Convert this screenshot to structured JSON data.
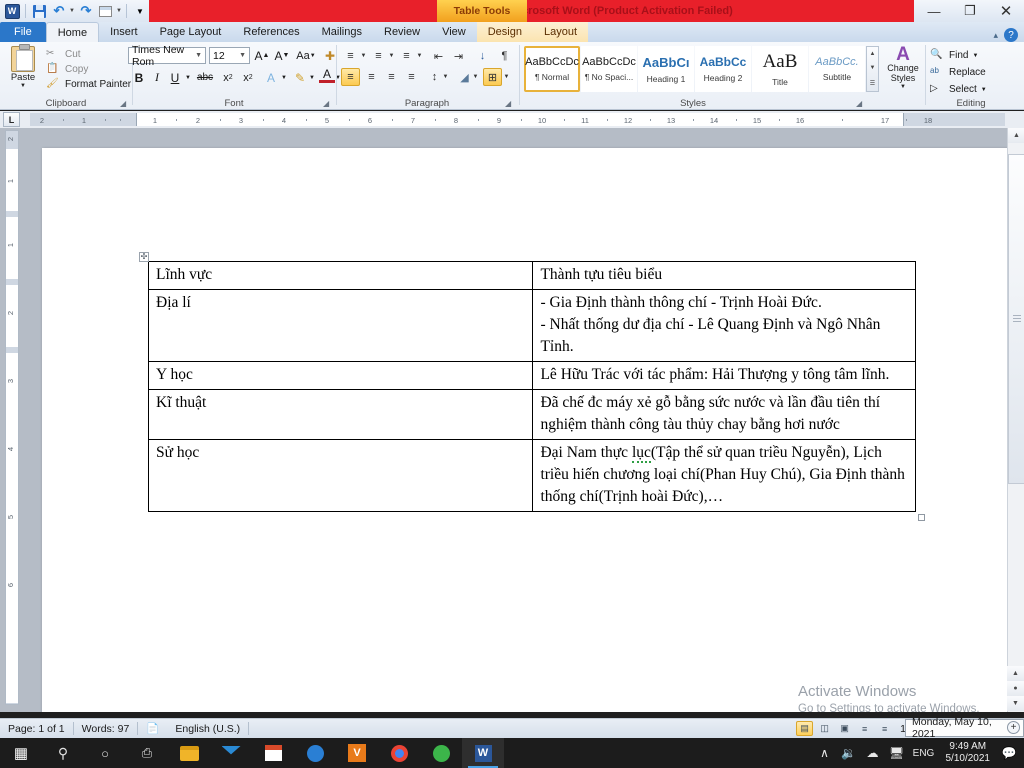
{
  "titlebar": {
    "app_icon": "word-logo-icon",
    "document_title": "Document1  -  Microsoft Word (Product Activation Failed)",
    "contextual_tab_group": "Table Tools",
    "quick_access": [
      {
        "name": "save-icon",
        "label": "Save"
      },
      {
        "name": "undo-icon",
        "label": "Undo"
      },
      {
        "name": "redo-icon",
        "label": "Redo"
      },
      {
        "name": "table-quick-icon",
        "label": "Table"
      },
      {
        "name": "customize-qat-icon",
        "label": "Customize Quick Access Toolbar"
      }
    ],
    "window_controls": [
      {
        "name": "minimize-button",
        "glyph": "—"
      },
      {
        "name": "restore-button",
        "glyph": "❐"
      },
      {
        "name": "close-button",
        "glyph": "✕"
      }
    ],
    "ribbon_collapse": "▴",
    "help": "?"
  },
  "tabs": [
    {
      "label": "File",
      "kind": "file"
    },
    {
      "label": "Home",
      "kind": "active"
    },
    {
      "label": "Insert",
      "kind": "normal"
    },
    {
      "label": "Page Layout",
      "kind": "normal"
    },
    {
      "label": "References",
      "kind": "normal"
    },
    {
      "label": "Mailings",
      "kind": "normal"
    },
    {
      "label": "Review",
      "kind": "normal"
    },
    {
      "label": "View",
      "kind": "normal"
    },
    {
      "label": "Design",
      "kind": "ctx"
    },
    {
      "label": "Layout",
      "kind": "ctx"
    }
  ],
  "ribbon": {
    "groups": [
      {
        "name": "clipboard",
        "label": "Clipboard"
      },
      {
        "name": "font",
        "label": "Font"
      },
      {
        "name": "paragraph",
        "label": "Paragraph"
      },
      {
        "name": "styles",
        "label": "Styles"
      },
      {
        "name": "editing",
        "label": "Editing"
      }
    ],
    "clipboard": {
      "paste_label": "Paste",
      "commands": [
        {
          "label": "Cut",
          "icon": "scissors-icon",
          "enabled": false
        },
        {
          "label": "Copy",
          "icon": "copy-icon",
          "enabled": false
        },
        {
          "label": "Format Painter",
          "icon": "format-painter-icon",
          "enabled": true
        }
      ]
    },
    "font": {
      "font_name": "Times New Rom",
      "font_size": "12",
      "buttons": [
        {
          "name": "grow-font-button",
          "glyph": "A˄"
        },
        {
          "name": "shrink-font-button",
          "glyph": "A˅"
        },
        {
          "name": "change-case-button",
          "glyph": "Aa"
        },
        {
          "name": "clear-formatting-button",
          "glyph": "✐"
        },
        {
          "name": "bold-button",
          "glyph": "B"
        },
        {
          "name": "italic-button",
          "glyph": "I"
        },
        {
          "name": "underline-button",
          "glyph": "U"
        },
        {
          "name": "strikethrough-button",
          "glyph": "abc"
        },
        {
          "name": "subscript-button",
          "glyph": "x₂"
        },
        {
          "name": "superscript-button",
          "glyph": "x²"
        },
        {
          "name": "text-effects-button",
          "glyph": "A"
        },
        {
          "name": "highlight-color-button",
          "glyph": "✐"
        },
        {
          "name": "font-color-button",
          "glyph": "A"
        }
      ]
    },
    "paragraph": {
      "buttons": [
        {
          "name": "bullets-button",
          "glyph": "≣"
        },
        {
          "name": "numbering-button",
          "glyph": "≣"
        },
        {
          "name": "multilevel-list-button",
          "glyph": "≣"
        },
        {
          "name": "decrease-indent-button",
          "glyph": "⇤"
        },
        {
          "name": "increase-indent-button",
          "glyph": "⇥"
        },
        {
          "name": "sort-button",
          "glyph": "↓"
        },
        {
          "name": "show-formatting-marks-button",
          "glyph": "¶"
        },
        {
          "name": "align-left-button",
          "glyph": "≡",
          "selected": true
        },
        {
          "name": "align-center-button",
          "glyph": "≡"
        },
        {
          "name": "align-right-button",
          "glyph": "≡"
        },
        {
          "name": "justify-button",
          "glyph": "≡"
        },
        {
          "name": "line-spacing-button",
          "glyph": "↕"
        },
        {
          "name": "shading-button",
          "glyph": "◢"
        },
        {
          "name": "borders-button",
          "glyph": "⊞"
        }
      ]
    },
    "styles": {
      "items": [
        {
          "preview": "AaBbCcDc",
          "name": "¶ Normal",
          "selected": true
        },
        {
          "preview": "AaBbCcDc",
          "name": "¶ No Spaci...",
          "selected": false
        },
        {
          "preview": "AaBbCı",
          "name": "Heading 1",
          "selected": false
        },
        {
          "preview": "AaBbCc",
          "name": "Heading 2",
          "selected": false
        },
        {
          "preview": "AaB",
          "name": "Title",
          "selected": false
        },
        {
          "preview": "AaBbCc.",
          "name": "Subtitle",
          "selected": false
        }
      ],
      "change_styles_label": "Change Styles"
    },
    "editing": {
      "commands": [
        {
          "label": "Find",
          "icon": "binoculars-icon",
          "dropdown": true
        },
        {
          "label": "Replace",
          "icon": "replace-icon",
          "dropdown": false
        },
        {
          "label": "Select",
          "icon": "select-arrow-icon",
          "dropdown": true
        }
      ]
    }
  },
  "ruler": {
    "tab_selector_glyph": "L",
    "horizontal_ticks": [
      "2",
      "1",
      "1",
      "2",
      "3",
      "4",
      "5",
      "6",
      "7",
      "8",
      "9",
      "10",
      "11",
      "12",
      "13",
      "14",
      "15",
      "16",
      "17",
      "18"
    ],
    "vertical_ticks": [
      "2",
      "1",
      "1",
      "2",
      "3",
      "4",
      "5",
      "6"
    ]
  },
  "document": {
    "table": {
      "columns": [
        "Lĩnh vực",
        "Thành tựu tiêu biểu"
      ],
      "rows": [
        {
          "field": "Địa lí",
          "achievement": "- Gia Định thành thông chí - Trịnh Hoài Đức.\n- Nhất thống dư địa chí - Lê Quang Định và Ngô Nhân Tỉnh."
        },
        {
          "field": "Y học",
          "achievement": "Lê Hữu Trác với tác phẩm: Hải Thượng y tông tâm lĩnh."
        },
        {
          "field": "Kĩ thuật",
          "achievement": "Đã chế đc máy xẻ gỗ bằng sức nước và lần đầu tiên thí  nghiệm thành công tàu thủy chay bằng hơi nước"
        },
        {
          "field": "Sử học",
          "achievement_pre": "Đại Nam thực ",
          "achievement_misspelled": "lục",
          "achievement_post": "(Tập thể sử quan triều Nguyễn), Lịch triều hiến chương loại chí(Phan Huy Chú), Gia Định thành thống chí(Trịnh hoài Đức),…"
        }
      ]
    },
    "watermark": {
      "line1": "Activate Windows",
      "line2": "Go to Settings to activate Windows."
    }
  },
  "statusbar": {
    "page": "Page: 1 of 1",
    "words": "Words: 97",
    "proofing_icon": "spelling-check-icon",
    "language": "English (U.S.)",
    "view_buttons": [
      {
        "name": "print-layout-view-button",
        "glyph": "▤",
        "selected": true
      },
      {
        "name": "full-screen-reading-view-button",
        "glyph": "◫",
        "selected": false
      },
      {
        "name": "web-layout-view-button",
        "glyph": "▣",
        "selected": false
      },
      {
        "name": "outline-view-button",
        "glyph": "≡",
        "selected": false
      },
      {
        "name": "draft-view-button",
        "glyph": "≡",
        "selected": false
      }
    ],
    "zoom_level": "150%",
    "tooltip": "Monday, May 10, 2021",
    "zoom_in_glyph": "+"
  },
  "taskbar": {
    "items": [
      {
        "name": "start-button",
        "glyph": "⊞"
      },
      {
        "name": "search-icon",
        "glyph": "⌕"
      },
      {
        "name": "cortana-icon",
        "glyph": "○"
      },
      {
        "name": "task-view-icon",
        "glyph": "⌸"
      },
      {
        "name": "file-explorer-icon",
        "glyph": ""
      },
      {
        "name": "mail-icon",
        "glyph": ""
      },
      {
        "name": "microsoft-store-icon",
        "glyph": ""
      },
      {
        "name": "edge-icon",
        "glyph": ""
      },
      {
        "name": "vietkey-icon",
        "glyph": "V"
      },
      {
        "name": "chrome-icon",
        "glyph": ""
      },
      {
        "name": "green-app-icon",
        "glyph": ""
      },
      {
        "name": "word-taskbar-icon",
        "glyph": "W",
        "active": true
      }
    ],
    "tray": {
      "show_hidden_glyph": "⌃",
      "volume_glyph": "🔊",
      "onedrive_glyph": "☁",
      "network_glyph": "❑",
      "language": "ENG",
      "time": "9:49 AM",
      "date": "5/10/2021",
      "action_center_glyph": "⧉"
    }
  }
}
